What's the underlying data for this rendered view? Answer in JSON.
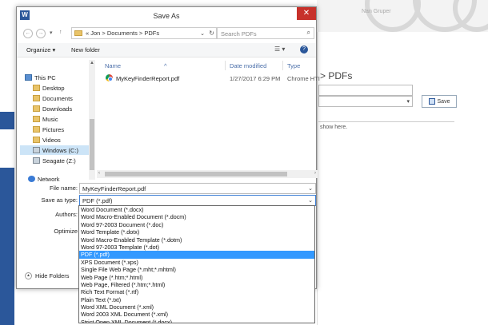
{
  "background": {
    "top_right_label": "Nan Gruper",
    "path_text": "> PDFs",
    "save_button": "Save",
    "note_text": "show here."
  },
  "dialog": {
    "title": "Save As",
    "app_icon": "W",
    "address": {
      "breadcrumb": "« Jon  >  Documents  >  PDFs",
      "search_placeholder": "Search PDFs"
    },
    "commandbar": {
      "organize": "Organize ▾",
      "new_folder": "New folder"
    },
    "nav_items": [
      {
        "label": "This PC",
        "icon": "pc-icon"
      },
      {
        "label": "Desktop",
        "icon": "folder-icon"
      },
      {
        "label": "Documents",
        "icon": "folder-icon"
      },
      {
        "label": "Downloads",
        "icon": "folder-icon"
      },
      {
        "label": "Music",
        "icon": "folder-icon"
      },
      {
        "label": "Pictures",
        "icon": "folder-icon"
      },
      {
        "label": "Videos",
        "icon": "folder-icon"
      },
      {
        "label": "Windows (C:)",
        "icon": "drive-icon"
      },
      {
        "label": "Seagate (Z:)",
        "icon": "drive-icon"
      },
      {
        "label": "Network",
        "icon": "network-icon"
      }
    ],
    "columns": {
      "name": "Name",
      "date_modified": "Date modified",
      "type": "Type"
    },
    "files": [
      {
        "name": "MyKeyFinderReport.pdf",
        "date": "1/27/2017 6:29 PM",
        "type": "Chrome HTI"
      }
    ],
    "form": {
      "file_name_label": "File name:",
      "file_name_value": "MyKeyFinderReport.pdf",
      "save_type_label": "Save as type:",
      "save_type_value": "PDF (*.pdf)",
      "authors_label": "Authors:",
      "optimize_label": "Optimize"
    },
    "hide_folders": "Hide Folders",
    "type_options": [
      "Word Document (*.docx)",
      "Word Macro-Enabled Document (*.docm)",
      "Word 97-2003 Document (*.doc)",
      "Word Template (*.dotx)",
      "Word Macro-Enabled Template (*.dotm)",
      "Word 97-2003 Template (*.dot)",
      "PDF (*.pdf)",
      "XPS Document (*.xps)",
      "Single File Web Page (*.mht;*.mhtml)",
      "Web Page (*.htm;*.html)",
      "Web Page, Filtered (*.htm;*.html)",
      "Rich Text Format (*.rtf)",
      "Plain Text (*.txt)",
      "Word XML Document (*.xml)",
      "Word 2003 XML Document (*.xml)",
      "Strict Open XML Document (*.docx)"
    ],
    "selected_type_index": 6
  }
}
